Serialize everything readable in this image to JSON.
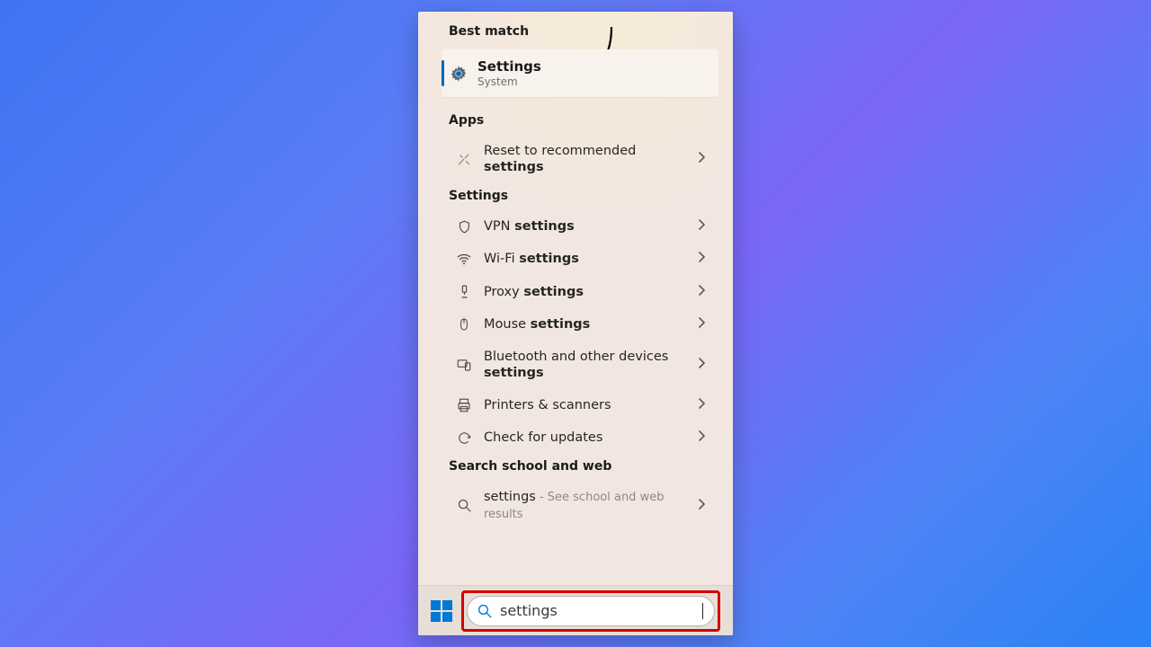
{
  "sections": {
    "best_match": "Best match",
    "apps": "Apps",
    "settings": "Settings",
    "search_web": "Search school and web"
  },
  "best": {
    "title": "Settings",
    "subtitle": "System"
  },
  "apps_rows": {
    "reset_pre": "Reset to recommended ",
    "reset_bold": "settings"
  },
  "settings_rows": {
    "vpn_pre": "VPN ",
    "vpn_bold": "settings",
    "wifi_pre": "Wi-Fi ",
    "wifi_bold": "settings",
    "proxy_pre": "Proxy ",
    "proxy_bold": "settings",
    "mouse_pre": "Mouse ",
    "mouse_bold": "settings",
    "bt_pre": "Bluetooth and other devices ",
    "bt_bold": "settings",
    "printers": "Printers & scanners",
    "updates": "Check for updates"
  },
  "web_row": {
    "query": "settings",
    "hint": " - See school and web results"
  },
  "search": {
    "value": "settings"
  }
}
